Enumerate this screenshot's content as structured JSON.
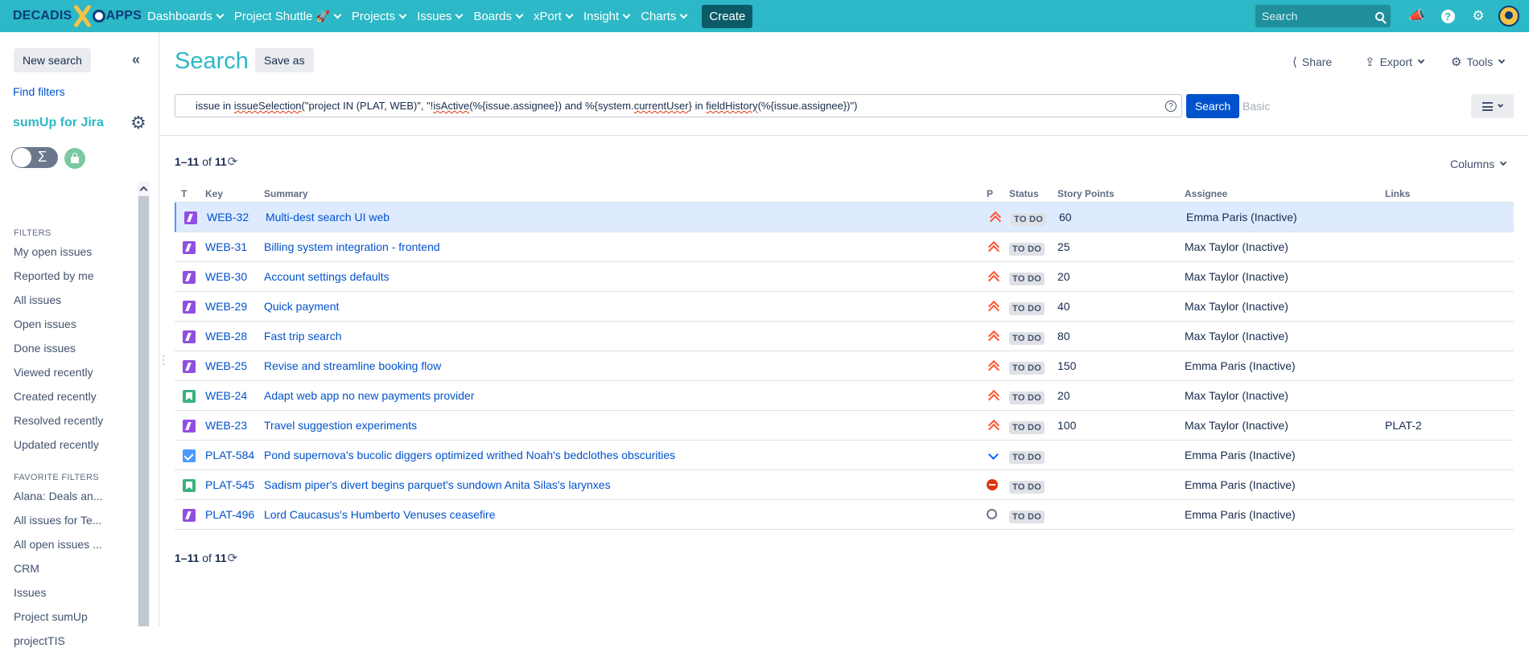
{
  "topnav": {
    "logo_left": "DECADIS",
    "logo_right": "APPS",
    "items": [
      {
        "label": "Dashboards"
      },
      {
        "label": "Project Shuttle"
      },
      {
        "label": "Projects"
      },
      {
        "label": "Issues"
      },
      {
        "label": "Boards"
      },
      {
        "label": "xPort"
      },
      {
        "label": "Insight"
      },
      {
        "label": "Charts"
      }
    ],
    "create_label": "Create",
    "search_placeholder": "Search",
    "icons": [
      "megaphone-icon",
      "help-icon",
      "gear-icon",
      "avatar"
    ]
  },
  "sidebar": {
    "new_search": "New search",
    "find_filters": "Find filters",
    "sumup_title": "sumUp for Jira",
    "toggle_symbol": "Σ",
    "filters_title": "FILTERS",
    "filters": [
      "My open issues",
      "Reported by me",
      "All issues",
      "Open issues",
      "Done issues",
      "Viewed recently",
      "Created recently",
      "Resolved recently",
      "Updated recently"
    ],
    "favorites_title": "FAVORITE FILTERS",
    "favorites": [
      "Alana: Deals an...",
      "All issues for Te...",
      "All open issues ...",
      "CRM",
      "Issues",
      "Project sumUp",
      "projectTIS"
    ]
  },
  "main": {
    "title": "Search",
    "save_as": "Save as",
    "share": "Share",
    "export": "Export",
    "tools": "Tools",
    "jql": {
      "p1": "issue in ",
      "p2": "issueSelection",
      "p3": "(\"project IN (PLAT, WEB)\", \"!",
      "p4": "isActive",
      "p5": "(%{issue.assignee}) and %{system.",
      "p6": "currentUser",
      "p7": "} in ",
      "p8": "fieldHistory",
      "p9": "(%{issue.assignee})\")"
    },
    "search_button": "Search",
    "basic_link": "Basic",
    "count_range": "1–11",
    "count_of": "of",
    "count_total": "11",
    "columns_label": "Columns"
  },
  "table": {
    "headers": {
      "t": "T",
      "key": "Key",
      "summary": "Summary",
      "p": "P",
      "status": "Status",
      "story_points": "Story Points",
      "assignee": "Assignee",
      "links": "Links"
    },
    "rows": [
      {
        "type": "story",
        "key": "WEB-32",
        "summary": "Multi-dest search UI web",
        "priority": "highest",
        "status": "TO DO",
        "story_points": "60",
        "assignee": "Emma Paris (Inactive)",
        "links": ""
      },
      {
        "type": "story",
        "key": "WEB-31",
        "summary": "Billing system integration - frontend",
        "priority": "highest",
        "status": "TO DO",
        "story_points": "25",
        "assignee": "Max Taylor (Inactive)",
        "links": ""
      },
      {
        "type": "story",
        "key": "WEB-30",
        "summary": "Account settings defaults",
        "priority": "highest",
        "status": "TO DO",
        "story_points": "20",
        "assignee": "Max Taylor (Inactive)",
        "links": ""
      },
      {
        "type": "story",
        "key": "WEB-29",
        "summary": "Quick payment",
        "priority": "highest",
        "status": "TO DO",
        "story_points": "40",
        "assignee": "Max Taylor (Inactive)",
        "links": ""
      },
      {
        "type": "story",
        "key": "WEB-28",
        "summary": "Fast trip search",
        "priority": "highest",
        "status": "TO DO",
        "story_points": "80",
        "assignee": "Max Taylor (Inactive)",
        "links": ""
      },
      {
        "type": "story",
        "key": "WEB-25",
        "summary": "Revise and streamline booking flow",
        "priority": "highest",
        "status": "TO DO",
        "story_points": "150",
        "assignee": "Emma Paris (Inactive)",
        "links": ""
      },
      {
        "type": "book",
        "key": "WEB-24",
        "summary": "Adapt web app no new payments provider",
        "priority": "highest",
        "status": "TO DO",
        "story_points": "20",
        "assignee": "Max Taylor (Inactive)",
        "links": ""
      },
      {
        "type": "story",
        "key": "WEB-23",
        "summary": "Travel suggestion experiments",
        "priority": "highest",
        "status": "TO DO",
        "story_points": "100",
        "assignee": "Max Taylor (Inactive)",
        "links": "PLAT-2"
      },
      {
        "type": "task",
        "key": "PLAT-584",
        "summary": "Pond supernova's bucolic diggers optimized writhed Noah's bedclothes obscurities",
        "priority": "low",
        "status": "TO DO",
        "story_points": "",
        "assignee": "Emma Paris (Inactive)",
        "links": ""
      },
      {
        "type": "book",
        "key": "PLAT-545",
        "summary": "Sadism piper's divert begins parquet's sundown Anita Silas's larynxes",
        "priority": "blocker",
        "status": "TO DO",
        "story_points": "",
        "assignee": "Emma Paris (Inactive)",
        "links": ""
      },
      {
        "type": "story",
        "key": "PLAT-496",
        "summary": "Lord Caucasus's Humberto Venuses ceasefire",
        "priority": "none",
        "status": "TO DO",
        "story_points": "",
        "assignee": "Emma Paris (Inactive)",
        "links": ""
      }
    ]
  }
}
